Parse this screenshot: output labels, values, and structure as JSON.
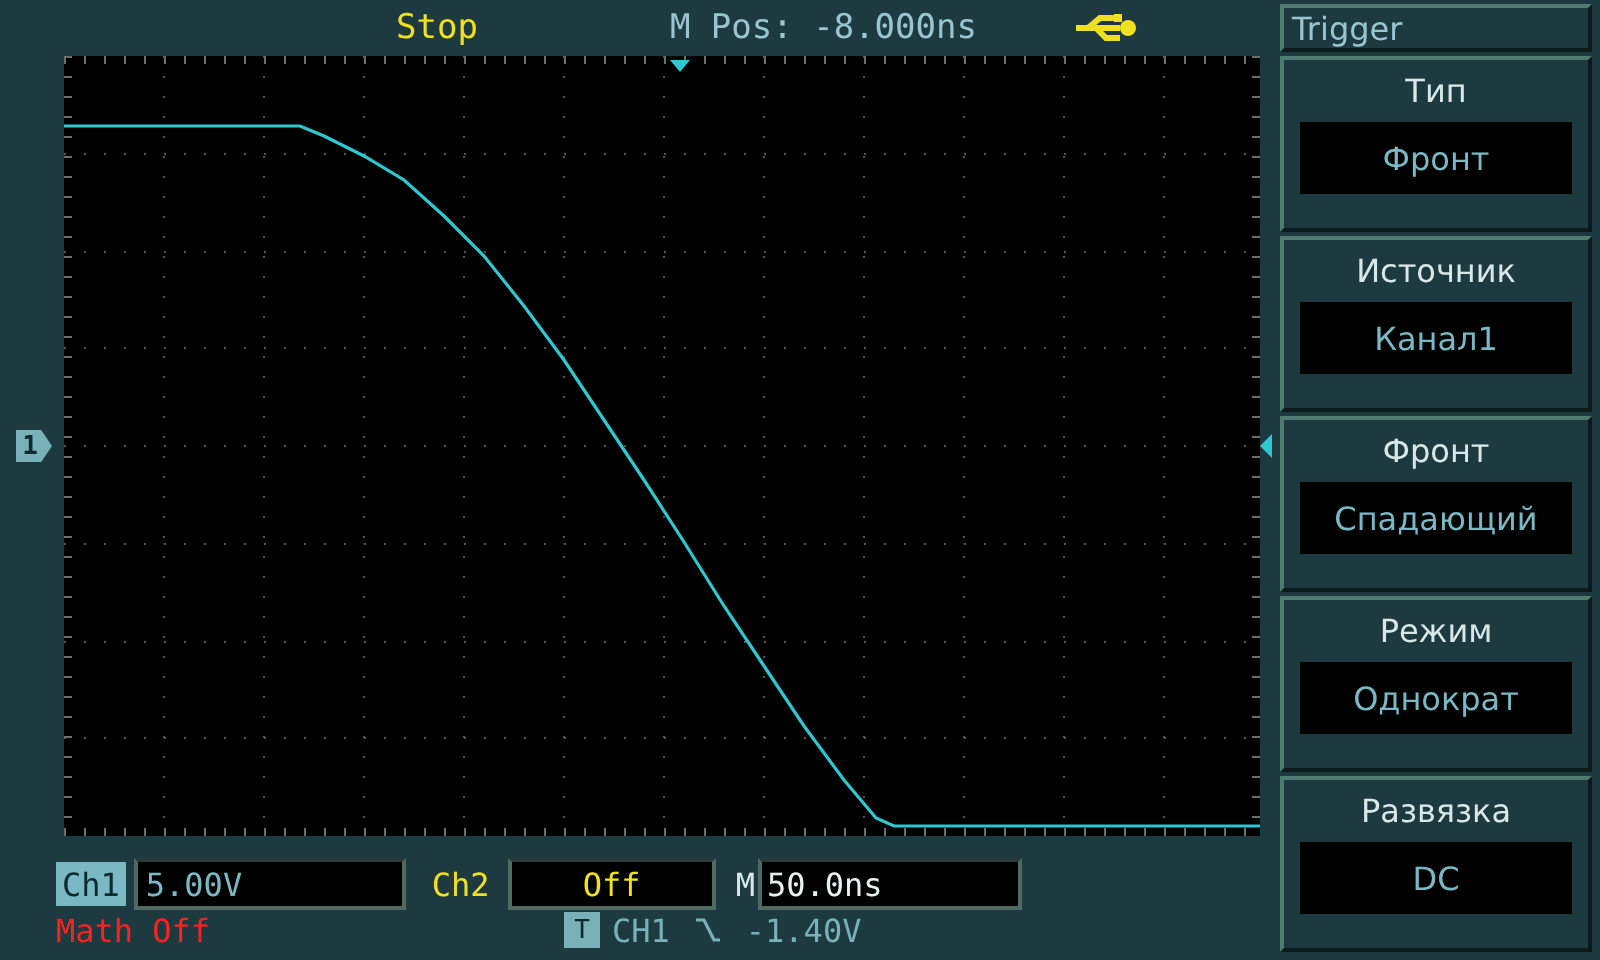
{
  "status_bar": {
    "run_state": "Stop",
    "position": "M Pos: -8.000ns"
  },
  "plot": {
    "channel_marker": "1"
  },
  "channels": [
    {
      "label": "Ch1",
      "value": "5.00V",
      "color": "#7ab8c4",
      "selected": true
    },
    {
      "label": "Ch2",
      "value": "Off",
      "color": "#f0e020",
      "selected": false
    }
  ],
  "timebase": {
    "label": "M",
    "value": "50.0ns"
  },
  "math": "Math Off",
  "trigger_info": {
    "badge": "T",
    "source": "CH1",
    "level": "-1.40V"
  },
  "menu": {
    "title": "Trigger",
    "items": [
      {
        "label": "Тип",
        "value": "Фронт"
      },
      {
        "label": "Источник",
        "value": "Канал1"
      },
      {
        "label": "Фронт",
        "value": "Спадающий"
      },
      {
        "label": "Режим",
        "value": "Однократ"
      },
      {
        "label": "Развязка",
        "value": "DC"
      }
    ]
  }
}
